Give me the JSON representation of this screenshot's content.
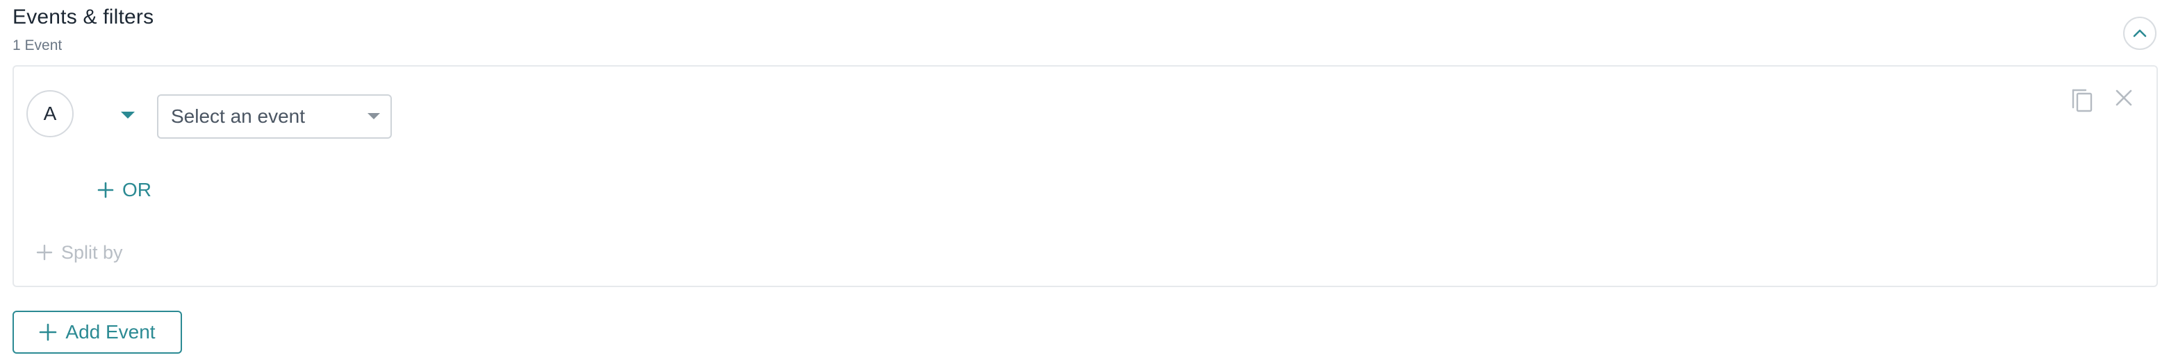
{
  "header": {
    "title": "Events & filters",
    "subtitle": "1 Event"
  },
  "event_row": {
    "letter": "A",
    "select": {
      "placeholder": "Select an event"
    },
    "or_label": "OR"
  },
  "split_by_label": "Split by",
  "add_event_label": "Add Event",
  "icons": {
    "collapse": "chevron-up-icon",
    "toggle": "caret-down-icon",
    "select_caret": "caret-down-icon",
    "or_plus": "plus-icon",
    "split_plus": "plus-icon",
    "copy": "copy-icon",
    "close": "close-icon",
    "add_plus": "plus-icon"
  },
  "colors": {
    "accent": "#2b8a93",
    "muted": "#b8bec5",
    "border": "#e6e9ec"
  }
}
